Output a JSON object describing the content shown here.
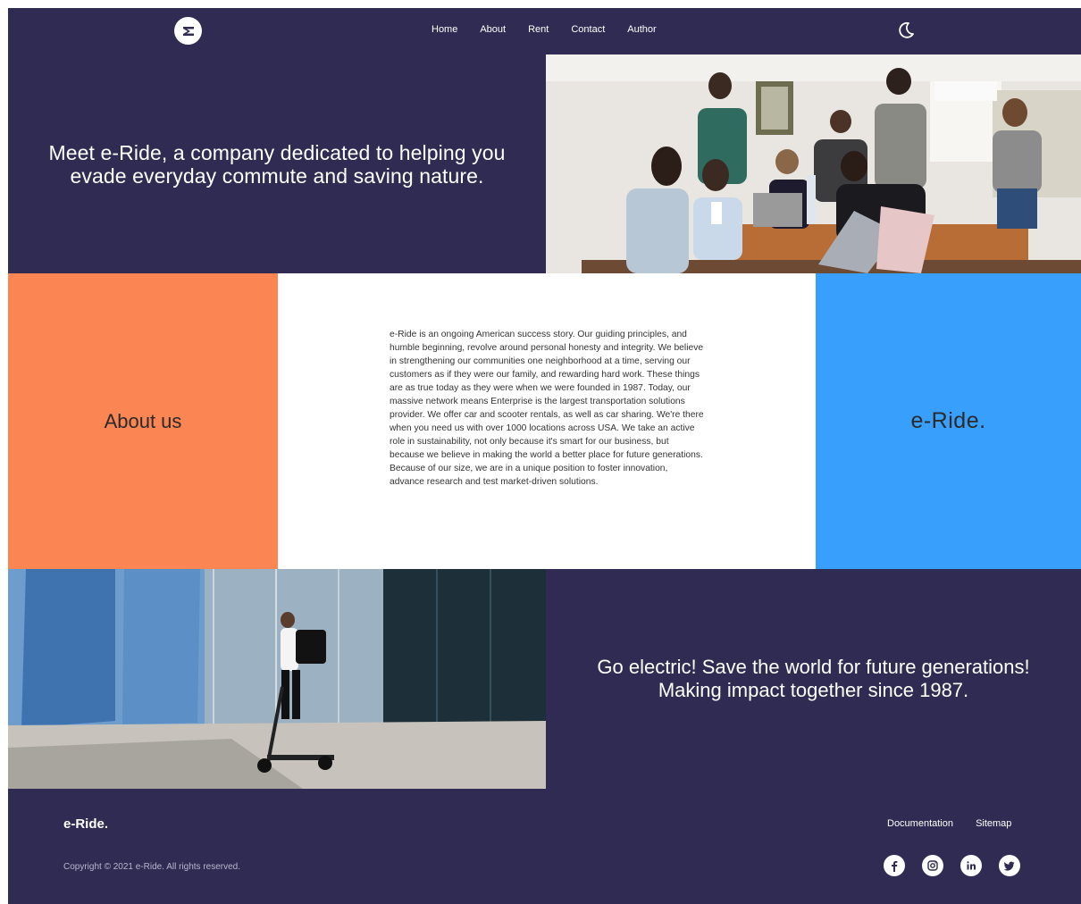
{
  "nav": {
    "logo_icon": "e-ride-logo-icon",
    "items": [
      {
        "label": "Home"
      },
      {
        "label": "About"
      },
      {
        "label": "Rent"
      },
      {
        "label": "Contact"
      },
      {
        "label": "Author"
      }
    ],
    "theme_toggle_icon": "moon-icon"
  },
  "hero": {
    "title": "Meet e-Ride, a company dedicated to helping you evade everyday commute and saving nature."
  },
  "about": {
    "heading": "About us",
    "body": "e-Ride is an ongoing American success story. Our guiding principles, and humble beginning, revolve around personal honesty and integrity. We believe in strengthening our communities one neighborhood at a time, serving our customers as if they were our family, and rewarding hard work. These things are as true today as they were when we were founded in 1987. Today, our massive network means Enterprise is the largest transportation solutions provider. We offer car and scooter rentals, as well as car sharing. We're there when you need us with over 1000 locations across USA. We take an active role in sustainability, not only because it's smart for our business, but because we believe in making the world a better place for future generations. Because of our size, we are in a unique position to foster innovation, advance research and test market-driven solutions.",
    "brand": "e-Ride."
  },
  "electric": {
    "line1": "Go electric! Save the world for future generations!",
    "line2": "Making impact together since 1987."
  },
  "footer": {
    "brand": "e-Ride.",
    "copyright": "Copyright © 2021 e-Ride. All rights reserved.",
    "links": [
      {
        "label": "Documentation"
      },
      {
        "label": "Sitemap"
      }
    ],
    "socials": [
      "facebook-icon",
      "instagram-icon",
      "linkedin-icon",
      "twitter-icon"
    ]
  },
  "colors": {
    "navy": "#2f2b52",
    "orange": "#fb8553",
    "blue": "#389ffd",
    "white": "#ffffff"
  }
}
